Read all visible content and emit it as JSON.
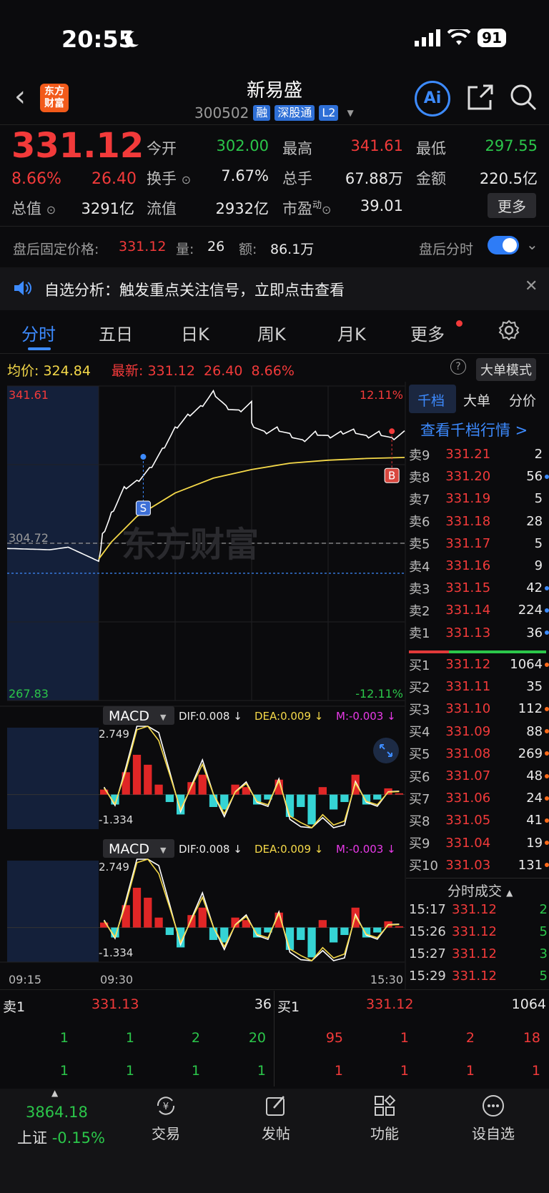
{
  "status": {
    "time": "20:55",
    "battery": "91"
  },
  "header": {
    "logo": "东方\n财富",
    "title": "新易盛",
    "code": "300502",
    "tags": [
      "融",
      "深股通",
      "L2"
    ],
    "ai_label": "Ai"
  },
  "quote": {
    "price": "331.12",
    "pct": "8.66%",
    "change": "26.40",
    "open_label": "今开",
    "open": "302.00",
    "high_label": "最高",
    "high": "341.61",
    "low_label": "最低",
    "low": "297.55",
    "turnover_label": "换手",
    "turnover": "7.67%",
    "volume_label": "总手",
    "volume": "67.88万",
    "amount_label": "金额",
    "amount": "220.5亿",
    "mktcap_label": "总值",
    "mktcap": "3291亿",
    "float_label": "流值",
    "float": "2932亿",
    "pe_label": "市盈",
    "pe_sup": "动",
    "pe": "39.01",
    "more": "更多"
  },
  "after_hours": {
    "label": "盘后固定价格:",
    "price": "331.12",
    "vol_label": "量:",
    "vol": "26",
    "amt_label": "额:",
    "amt": "86.1万",
    "timeshare_label": "盘后分时"
  },
  "notice": {
    "text": "自选分析：触发重点关注信号，立即点击查看"
  },
  "tabs": [
    "分时",
    "五日",
    "日K",
    "周K",
    "月K",
    "更多"
  ],
  "legend": {
    "avg_label": "均价:",
    "avg": "324.84",
    "last_label": "最新:",
    "last": "331.12",
    "chg": "26.40",
    "pct": "8.66%",
    "big_order": "大单模式"
  },
  "chart_data": [
    {
      "type": "line",
      "title": "",
      "x_labels": [
        "09:15",
        "09:30",
        "15:30"
      ],
      "y_axis_left": [
        "341.61",
        "304.72",
        "267.83"
      ],
      "y_axis_right": [
        "12.11%",
        "-12.11%"
      ],
      "prev_close": 304.72,
      "ylim": [
        267.83,
        341.61
      ],
      "series": [
        {
          "name": "",
          "color": "#ffffff",
          "x": [
            "09:15",
            "09:22",
            "09:25",
            "09:30",
            "09:33",
            "09:40",
            "09:50",
            "10:00",
            "10:10",
            "10:20",
            "10:30",
            "10:40",
            "10:50",
            "11:00",
            "11:10",
            "11:20",
            "11:30",
            "13:00",
            "13:10",
            "13:20",
            "13:30",
            "13:40",
            "13:50",
            "14:00",
            "14:10",
            "14:20",
            "14:30",
            "14:40",
            "14:50",
            "15:00",
            "15:30"
          ],
          "y": [
            303.5,
            303.2,
            303.8,
            300.5,
            307,
            312,
            318,
            319.5,
            322.5,
            327,
            332,
            335,
            337,
            340.5,
            337,
            336,
            338,
            333,
            331,
            332,
            330.5,
            329,
            331,
            330,
            331,
            331.5,
            330,
            331,
            329.5,
            331.12,
            331.12
          ]
        },
        {
          "name": "",
          "color": "#f5d949",
          "x": [
            "09:30",
            "09:40",
            "10:00",
            "10:30",
            "11:00",
            "11:30",
            "13:30",
            "14:00",
            "14:30",
            "15:00",
            "15:30"
          ],
          "y": [
            301,
            305,
            311,
            316.5,
            320,
            322,
            323.5,
            324.2,
            324.6,
            324.84,
            324.84
          ]
        }
      ],
      "markers": [
        {
          "label": "S",
          "x": "10:05"
        },
        {
          "label": "B",
          "x": "14:50"
        }
      ],
      "watermark": "东方财富"
    },
    {
      "type": "bar",
      "title": "MACD",
      "legend": {
        "dif": "DIF:0.008 ↓",
        "dea": "DEA:0.009 ↓",
        "m": "M:-0.003 ↓"
      },
      "ylim": [
        -1.334,
        2.749
      ],
      "y_labels": [
        "2.749",
        "-1.334"
      ],
      "values": [
        0.2,
        -0.4,
        0.9,
        1.6,
        1.2,
        0.4,
        -0.3,
        -0.8,
        0.5,
        0.8,
        -0.5,
        -0.6,
        0.4,
        0.3,
        -0.4,
        -0.2,
        0.6,
        -0.9,
        -0.5,
        -1.2,
        0.3,
        -0.6,
        -0.3,
        0.8,
        -0.4,
        -0.2,
        0.25,
        0.05
      ]
    },
    {
      "type": "bar",
      "title": "MACD",
      "legend": {
        "dif": "DIF:0.008 ↓",
        "dea": "DEA:0.009 ↓",
        "m": "M:-0.003 ↓"
      },
      "ylim": [
        -1.334,
        2.749
      ],
      "y_labels": [
        "2.749",
        "-1.334"
      ],
      "values": [
        0.2,
        -0.4,
        0.9,
        1.6,
        1.2,
        0.4,
        -0.3,
        -0.8,
        0.5,
        0.8,
        -0.5,
        -0.6,
        0.4,
        0.3,
        -0.4,
        -0.2,
        0.6,
        -0.9,
        -0.5,
        -1.2,
        0.3,
        -0.6,
        -0.3,
        0.8,
        -0.4,
        -0.2,
        0.25,
        0.05
      ]
    }
  ],
  "orderbook": {
    "tabs": [
      "千档",
      "大单",
      "分价"
    ],
    "link": "查看千档行情 >",
    "asks": [
      {
        "label": "卖9",
        "price": "331.21",
        "vol": "2",
        "dot": ""
      },
      {
        "label": "卖8",
        "price": "331.20",
        "vol": "56",
        "dot": "#3d8bff"
      },
      {
        "label": "卖7",
        "price": "331.19",
        "vol": "5",
        "dot": ""
      },
      {
        "label": "卖6",
        "price": "331.18",
        "vol": "28",
        "dot": ""
      },
      {
        "label": "卖5",
        "price": "331.17",
        "vol": "5",
        "dot": ""
      },
      {
        "label": "卖4",
        "price": "331.16",
        "vol": "9",
        "dot": ""
      },
      {
        "label": "卖3",
        "price": "331.15",
        "vol": "42",
        "dot": "#3d8bff"
      },
      {
        "label": "卖2",
        "price": "331.14",
        "vol": "224",
        "dot": "#3d8bff"
      },
      {
        "label": "卖1",
        "price": "331.13",
        "vol": "36",
        "dot": "#3d8bff"
      }
    ],
    "bids": [
      {
        "label": "买1",
        "price": "331.12",
        "vol": "1064",
        "dot": "#ff6a1a"
      },
      {
        "label": "买2",
        "price": "331.11",
        "vol": "35",
        "dot": ""
      },
      {
        "label": "买3",
        "price": "331.10",
        "vol": "112",
        "dot": "#ff6a1a"
      },
      {
        "label": "买4",
        "price": "331.09",
        "vol": "88",
        "dot": "#ff6a1a"
      },
      {
        "label": "买5",
        "price": "331.08",
        "vol": "269",
        "dot": "#ff6a1a"
      },
      {
        "label": "买6",
        "price": "331.07",
        "vol": "48",
        "dot": "#ff6a1a"
      },
      {
        "label": "买7",
        "price": "331.06",
        "vol": "24",
        "dot": "#ff6a1a"
      },
      {
        "label": "买8",
        "price": "331.05",
        "vol": "41",
        "dot": "#ff6a1a"
      },
      {
        "label": "买9",
        "price": "331.04",
        "vol": "19",
        "dot": "#ff6a1a"
      },
      {
        "label": "买10",
        "price": "331.03",
        "vol": "131",
        "dot": "#ff6a1a"
      }
    ],
    "trades_title": "分时成交",
    "trades": [
      {
        "time": "15:17",
        "price": "331.12",
        "vol": "2"
      },
      {
        "time": "15:26",
        "price": "331.12",
        "vol": "5"
      },
      {
        "time": "15:27",
        "price": "331.12",
        "vol": "3"
      },
      {
        "time": "15:29",
        "price": "331.12",
        "vol": "5"
      }
    ]
  },
  "depth": {
    "ask_label": "卖1",
    "ask_price": "331.13",
    "ask_vol": "36",
    "bid_label": "买1",
    "bid_price": "331.12",
    "bid_vol": "1064",
    "ask_row1": [
      "1",
      "1",
      "2",
      "20"
    ],
    "ask_row2": [
      "1",
      "1",
      "1",
      "1"
    ],
    "bid_row1": [
      "95",
      "1",
      "2",
      "18"
    ],
    "bid_row2": [
      "1",
      "1",
      "1",
      "1"
    ]
  },
  "nav": {
    "index_value": "3864.18",
    "index_name": "上证",
    "index_pct": "-0.15%",
    "items": [
      "交易",
      "发帖",
      "功能",
      "设自选"
    ]
  }
}
